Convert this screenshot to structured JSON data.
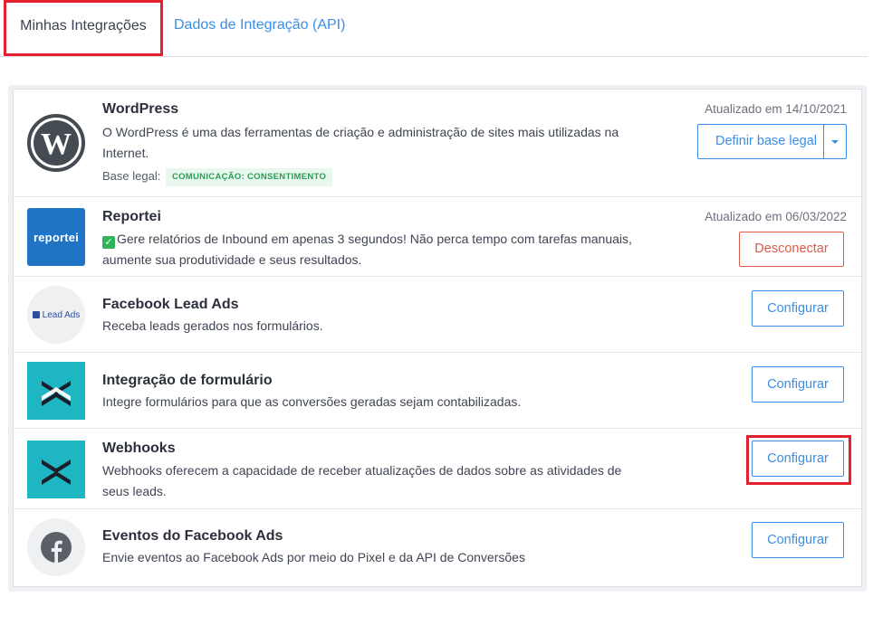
{
  "tabs": {
    "active": "Minhas Integrações",
    "api": "Dados de Integração (API)"
  },
  "integrations": [
    {
      "name": "WordPress",
      "description": "O WordPress é uma das ferramentas de criação e administração de sites mais utilizadas na Internet.",
      "legal_label": "Base legal:",
      "legal_badge": "COMUNICAÇÃO: CONSENTIMENTO",
      "updated": "Atualizado em 14/10/2021",
      "button": "Definir base legal",
      "icon": "wordpress-logo"
    },
    {
      "name": "Reportei",
      "description": "Gere relatórios de Inbound em apenas 3 segundos! Não perca tempo com tarefas manuais, aumente sua produtividade e seus resultados.",
      "logo_text": "reportei",
      "updated": "Atualizado em 06/03/2022",
      "button": "Desconectar",
      "icon": "reportei-logo"
    },
    {
      "name": "Facebook Lead Ads",
      "description": "Receba leads gerados nos formulários.",
      "logo_text": "Lead Ads",
      "button": "Configurar",
      "icon": "facebook-lead-ads-logo"
    },
    {
      "name": "Integração de formulário",
      "description": "Integre formulários para que as conversões geradas sejam contabilizadas.",
      "button": "Configurar",
      "icon": "form-integration-logo"
    },
    {
      "name": "Webhooks",
      "description": "Webhooks oferecem a capacidade de receber atualizações de dados sobre as atividades de seus leads.",
      "button": "Configurar",
      "icon": "webhooks-logo"
    },
    {
      "name": "Eventos do Facebook Ads",
      "description": "Envie eventos ao Facebook Ads por meio do Pixel e da API de Conversões",
      "button": "Configurar",
      "icon": "facebook-logo"
    }
  ],
  "colors": {
    "accent": "#3a8ee6",
    "danger": "#e05a49",
    "highlight": "#e5202e",
    "teal": "#1eb6c3",
    "reportei_blue": "#1f74c6",
    "badge_green": "#2a9c57"
  }
}
